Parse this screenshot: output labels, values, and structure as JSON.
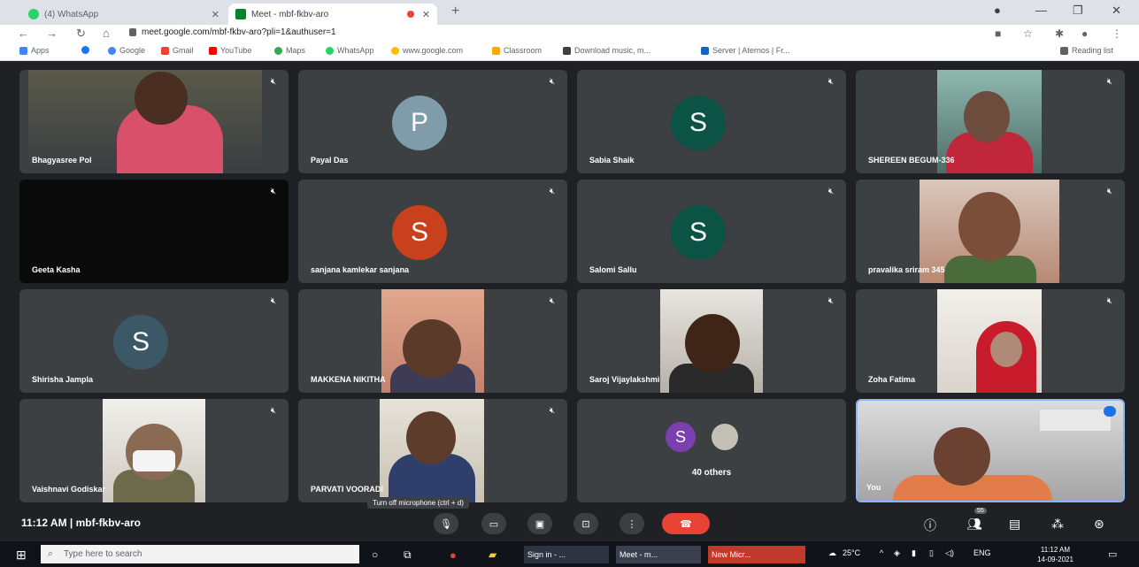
{
  "browser": {
    "tabs": [
      {
        "label": "(4) WhatsApp"
      },
      {
        "label": "Meet - mbf-fkbv-aro"
      }
    ],
    "url": "meet.google.com/mbf-fkbv-aro?pli=1&authuser=1",
    "bookmarks": [
      "Apps",
      "Google",
      "Gmail",
      "YouTube",
      "Maps",
      "WhatsApp",
      "www.google.com",
      "Classroom",
      "Download music, m...",
      "Server | Aternos | Fr..."
    ],
    "reading_list": "Reading list"
  },
  "participants": [
    {
      "name": "Bhagyasree Pol",
      "type": "video"
    },
    {
      "name": "Payal Das",
      "type": "avatar",
      "initial": "P",
      "color": "#7f9cab"
    },
    {
      "name": "Sabia Shaik",
      "type": "avatar",
      "initial": "S",
      "color": "#0b5344"
    },
    {
      "name": "SHEREEN BEGUM-336",
      "type": "video"
    },
    {
      "name": "Geeta Kasha",
      "type": "dark"
    },
    {
      "name": "sanjana kamlekar sanjana",
      "type": "avatar",
      "initial": "S",
      "color": "#c8401c"
    },
    {
      "name": "Salomi Sallu",
      "type": "avatar",
      "initial": "S",
      "color": "#0b5344"
    },
    {
      "name": "pravalika sriram 345",
      "type": "video"
    },
    {
      "name": "Shirisha Jampla",
      "type": "avatar",
      "initial": "S",
      "color": "#3c5766"
    },
    {
      "name": "MAKKENA NIKITHA",
      "type": "video"
    },
    {
      "name": "Saroj Vijaylakshmi",
      "type": "video"
    },
    {
      "name": "Zoha Fatima",
      "type": "video"
    },
    {
      "name": "Vaishnavi Godiskar",
      "type": "video"
    },
    {
      "name": "PARVATI VOORADI",
      "type": "video"
    },
    {
      "name": "40 others",
      "type": "others",
      "initial": "S",
      "color": "#7b3fb0"
    },
    {
      "name": "You",
      "type": "self"
    }
  ],
  "meeting": {
    "time": "11:12 AM",
    "code": "mbf-fkbv-aro",
    "tooltip": "Turn off microphone (ctrl + d)",
    "people_count": "55"
  },
  "taskbar": {
    "search_placeholder": "Type here to search",
    "apps": [
      "Sign in - ...",
      "Meet - m...",
      "New Micr..."
    ],
    "weather": "25°C",
    "language": "ENG",
    "time": "11:12 AM",
    "date": "14-09-2021"
  }
}
